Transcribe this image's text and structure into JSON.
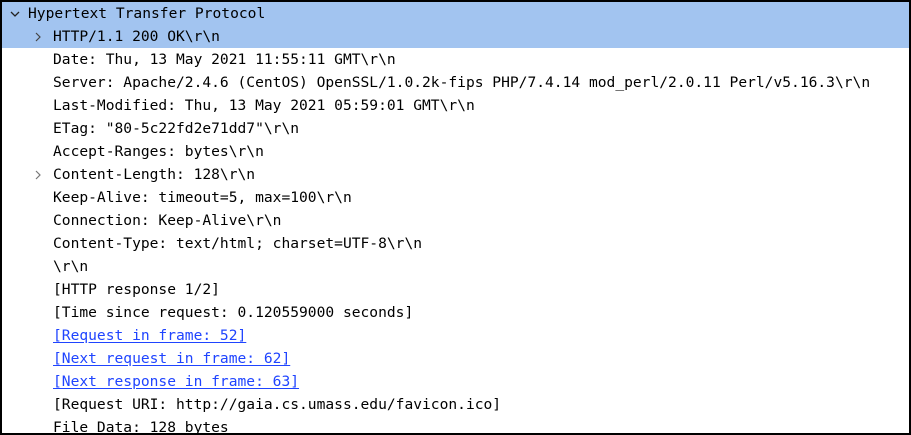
{
  "colors": {
    "selection": "#a2c4f0",
    "link": "#1f44ff",
    "text": "#000000"
  },
  "tree": {
    "root": {
      "label": "Hypertext Transfer Protocol",
      "expanded": true,
      "icon": "chevron-down-icon"
    },
    "items": [
      {
        "label": "HTTP/1.1 200 OK\\r\\n",
        "expandable": true,
        "selected": true,
        "icon": "chevron-right-icon"
      },
      {
        "label": "Date: Thu, 13 May 2021 11:55:11 GMT\\r\\n"
      },
      {
        "label": "Server: Apache/2.4.6 (CentOS) OpenSSL/1.0.2k-fips PHP/7.4.14 mod_perl/2.0.11 Perl/v5.16.3\\r\\n"
      },
      {
        "label": "Last-Modified: Thu, 13 May 2021 05:59:01 GMT\\r\\n"
      },
      {
        "label": "ETag: \"80-5c22fd2e71dd7\"\\r\\n"
      },
      {
        "label": "Accept-Ranges: bytes\\r\\n"
      },
      {
        "label": "Content-Length: 128\\r\\n",
        "expandable": true,
        "icon": "chevron-right-icon"
      },
      {
        "label": "Keep-Alive: timeout=5, max=100\\r\\n"
      },
      {
        "label": "Connection: Keep-Alive\\r\\n"
      },
      {
        "label": "Content-Type: text/html; charset=UTF-8\\r\\n"
      },
      {
        "label": "\\r\\n"
      },
      {
        "label": "[HTTP response 1/2]"
      },
      {
        "label": "[Time since request: 0.120559000 seconds]"
      },
      {
        "label": "[Request in frame: 52]",
        "link": true
      },
      {
        "label": "[Next request in frame: 62]",
        "link": true
      },
      {
        "label": "[Next response in frame: 63]",
        "link": true
      },
      {
        "label": "[Request URI: http://gaia.cs.umass.edu/favicon.ico]"
      },
      {
        "label": "File Data: 128 bytes"
      }
    ]
  }
}
